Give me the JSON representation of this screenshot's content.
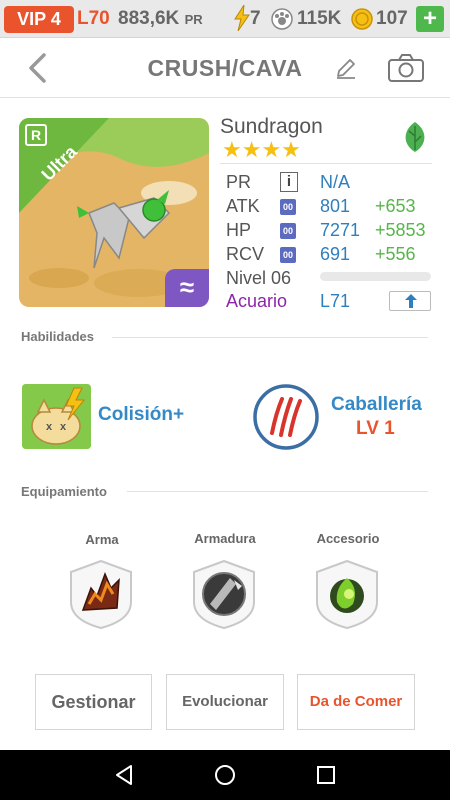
{
  "status": {
    "vip": "VIP 4",
    "level": "L70",
    "power": "883,6K",
    "power_unit": "PR",
    "energy": "7",
    "food": "115K",
    "coins": "107",
    "add": "+"
  },
  "header": {
    "title": "CRUSH/CAVA"
  },
  "monster": {
    "rank": "R",
    "grade": "Ultra",
    "element_symbol": "≈",
    "name": "Sundragon",
    "stars": "★★★★",
    "stats": [
      {
        "label": "PR",
        "value": "N/A",
        "bonus": "",
        "icon": "i"
      },
      {
        "label": "ATK",
        "value": "801",
        "bonus": "+653",
        "icon": "00"
      },
      {
        "label": "HP",
        "value": "7271",
        "bonus": "+5853",
        "icon": "00"
      },
      {
        "label": "RCV",
        "value": "691",
        "bonus": "+556",
        "icon": "00"
      }
    ],
    "level_label": "Nivel 06",
    "level_progress": 0,
    "attribute": "Acuario",
    "attribute_level": "L71"
  },
  "skills": {
    "title": "Habilidades",
    "skill1": "Colisión+",
    "skill2": "Caballería",
    "skill2_level": "LV 1"
  },
  "equipment": {
    "title": "Equipamiento",
    "slots": [
      "Arma",
      "Armadura",
      "Accesorio"
    ]
  },
  "actions": {
    "manage": "Gestionar",
    "evolve": "Evolucionar",
    "feed": "Da de Comer"
  },
  "colors": {
    "accent": "#e9542d",
    "link": "#3589c6",
    "bonus": "#57b54a",
    "attribute": "#8e24aa"
  }
}
